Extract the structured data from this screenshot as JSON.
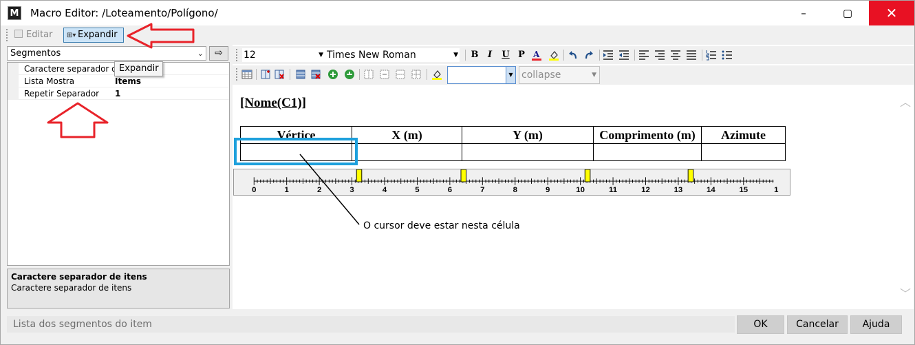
{
  "window": {
    "app_icon": "M",
    "title": "Macro Editor: /Loteamento/Polígono/",
    "controls": {
      "minimize": "–",
      "maximize": "▢",
      "close": "✕"
    }
  },
  "toolbar": {
    "editar_label": "Editar",
    "expandir_label": "Expandir"
  },
  "left_panel": {
    "segment_select": "Segmentos",
    "go_button": "⇨",
    "properties": [
      {
        "name": "Caractere separador de itens",
        "value": ""
      },
      {
        "name": "Lista Mostra",
        "value": "Items"
      },
      {
        "name": "Repetir Separador",
        "value": "1"
      }
    ],
    "tooltip": "Expandir",
    "description_title": "Caractere separador de itens",
    "description_text": "Caractere separador de itens"
  },
  "format_bar": {
    "font_size": "12",
    "font_name": "Times New Roman",
    "bold": "B",
    "italic": "I",
    "underline": "U",
    "paragraph": "P",
    "border_collapse": "collapse"
  },
  "document": {
    "heading": "[Nome(C1)]",
    "table_headers": [
      "Vértice",
      "X (m)",
      "Y (m)",
      "Comprimento (m)",
      "Azimute"
    ],
    "ruler_labels": [
      "0",
      "1",
      "2",
      "3",
      "4",
      "5",
      "6",
      "7",
      "8",
      "9",
      "10",
      "11",
      "12",
      "13",
      "14",
      "15",
      "1"
    ],
    "annotation": "O cursor deve estar nesta célula"
  },
  "status_bar": {
    "text": "Lista dos segmentos do item"
  },
  "buttons": {
    "ok": "OK",
    "cancel": "Cancelar",
    "help": "Ajuda"
  },
  "colors": {
    "highlight_box": "#1ea0dc",
    "arrow_red": "#e8232a",
    "marker_yellow": "#ffff00",
    "close_red": "#e81123"
  }
}
